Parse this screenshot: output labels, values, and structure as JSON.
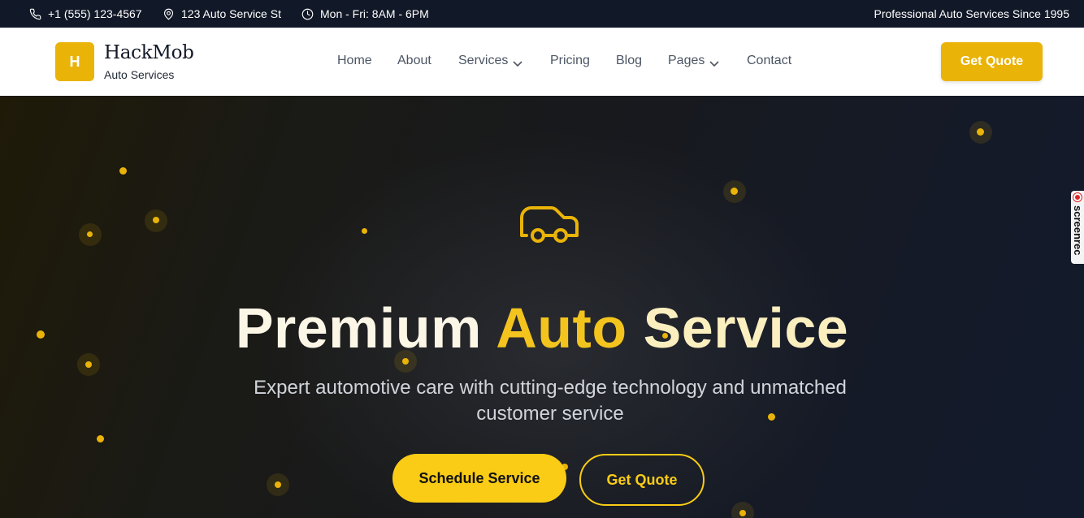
{
  "topbar": {
    "phone": "+1 (555) 123-4567",
    "address": "123 Auto Service St",
    "hours": "Mon - Fri: 8AM - 6PM",
    "tagline": "Professional Auto Services Since 1995"
  },
  "header": {
    "logo_letter": "H",
    "brand_name": "HackMob",
    "brand_sub": "Auto Services",
    "nav": [
      "Home",
      "About",
      "Services",
      "Pricing",
      "Blog",
      "Pages",
      "Contact"
    ],
    "quote_label": "Get Quote"
  },
  "hero": {
    "title_1": "Premium",
    "title_2": "Auto",
    "title_3": "Service",
    "subtitle": "Expert automotive care with cutting-edge technology and unmatched customer service",
    "primary_label": "Schedule Service",
    "secondary_label": "Get Quote"
  },
  "widget": {
    "label": "screenrec"
  },
  "colors": {
    "accent": "#eab308",
    "accent_bright": "#facc15",
    "topbar_bg": "#111827"
  },
  "icons": [
    "phone-icon",
    "map-pin-icon",
    "clock-icon",
    "chevron-down-icon",
    "car-icon"
  ]
}
